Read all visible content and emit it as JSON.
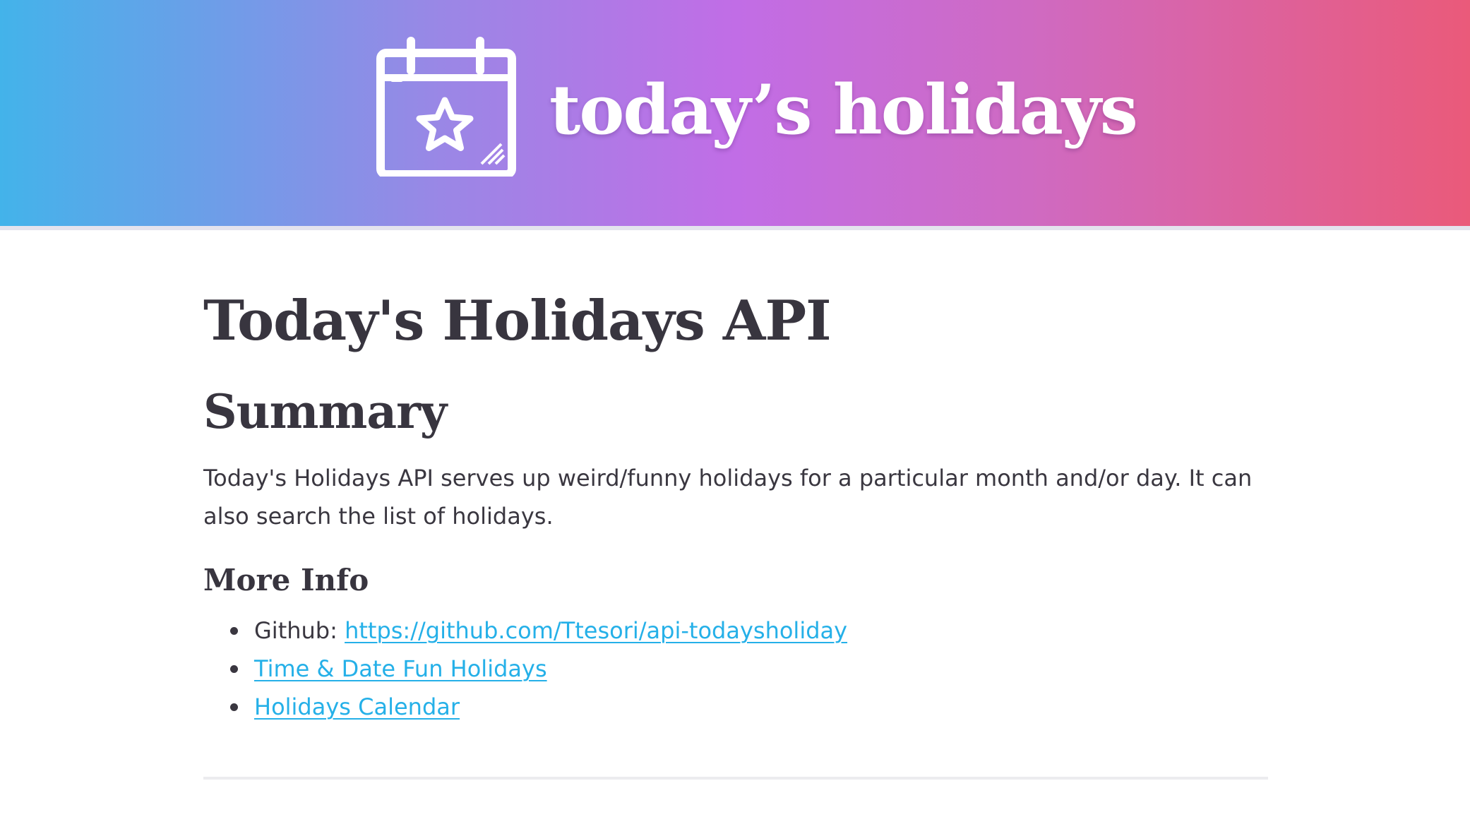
{
  "header": {
    "logo_icon": "calendar-star-icon",
    "title": "today’s holidays",
    "gradient_colors": [
      "#43b3ea",
      "#c16de6",
      "#ea5a7a"
    ]
  },
  "main": {
    "heading": "Today's Holidays API",
    "summary_heading": "Summary",
    "summary_text": "Today's Holidays API serves up weird/funny holidays for a particular month and/or day. It can also search the list of holidays.",
    "more_info_heading": "More Info",
    "links": [
      {
        "prefix": "Github: ",
        "label": "https://github.com/Ttesori/api-todaysholiday"
      },
      {
        "prefix": "",
        "label": "Time & Date Fun Holidays"
      },
      {
        "prefix": "",
        "label": "Holidays Calendar"
      }
    ]
  },
  "colors": {
    "text": "#3a3740",
    "link": "#25b0e8"
  }
}
